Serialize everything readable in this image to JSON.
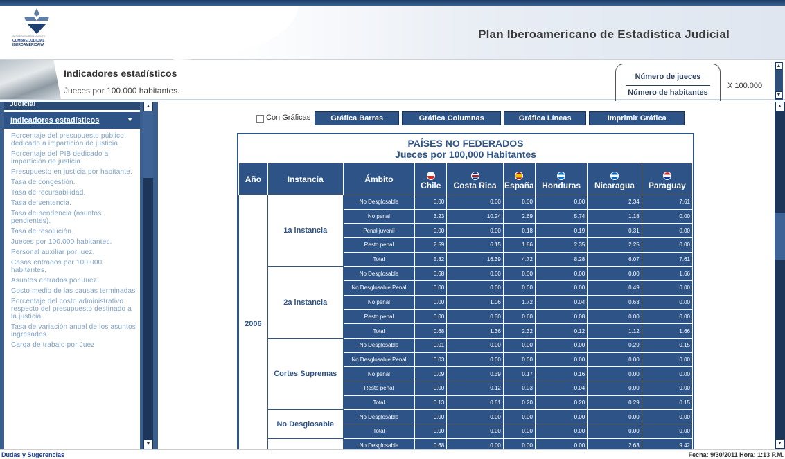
{
  "header": {
    "site_title": "Plan Iberoamericano de Estadística Judicial",
    "logo_small": "SECRETARIA PERMANENTE",
    "logo_line1": "CUMBRE JUDICIAL",
    "logo_line2": "IBEROAMERICANA"
  },
  "subheader": {
    "title": "Indicadores estadísticos",
    "description": "Jueces por 100.000 habitantes.",
    "numerator": "Número de jueces",
    "denominator": "Número de habitantes",
    "multiplier": "X 100.000"
  },
  "sidebar": {
    "partial_item": "Judicial",
    "section": "Indicadores estadísticos",
    "items": [
      "Porcentaje del presupuesto público dedicado a impartición de justicia",
      "Porcentaje del PIB dedicado a impartición de justicia",
      "Presupuesto en justicia por habitante.",
      "Tasa de congestión.",
      "Tasa de recursabilidad.",
      "Tasa de sentencia.",
      "Tasa de pendencia (asuntos pendientes).",
      "Tasa de resolución.",
      "Jueces por 100.000 habitantes.",
      "Personal auxiliar por juez.",
      "Casos entrados por 100.000 habitantes.",
      "Asuntos entrados por Juez.",
      "Costo medio de las causas terminadas",
      "Porcentaje del costo administrativo respecto del presupuesto destinado a la justicia",
      "Tasa de variación anual de los asuntos ingresados.",
      "Carga de trabajo por Juez"
    ]
  },
  "controls": {
    "checkbox_label": "Con Gráficas",
    "btn_bars": "Gráfica Barras",
    "btn_columns": "Gráfica Columnas",
    "btn_lines": "Gráfica Líneas",
    "btn_print": "Imprimir Gráfica"
  },
  "table": {
    "title_line1": "PAÍSES NO FEDERADOS",
    "title_line2": "Jueces por 100,000 Habitantes",
    "headers": [
      "Año",
      "Instancia",
      "Ámbito",
      "Chile",
      "Costa Rica",
      "España",
      "Honduras",
      "Nicaragua",
      "Paraguay"
    ],
    "year": "2006",
    "groups": [
      {
        "instancia": "1a instancia",
        "rows": [
          {
            "ambito": "No Desglosable",
            "v": [
              "0.00",
              "0.00",
              "0.00",
              "0.00",
              "2.34",
              "7.61"
            ]
          },
          {
            "ambito": "No penal",
            "v": [
              "3.23",
              "10.24",
              "2.69",
              "5.74",
              "1.18",
              "0.00"
            ]
          },
          {
            "ambito": "Penal juvenil",
            "v": [
              "0.00",
              "0.00",
              "0.18",
              "0.19",
              "0.31",
              "0.00"
            ]
          },
          {
            "ambito": "Resto penal",
            "v": [
              "2.59",
              "6.15",
              "1.86",
              "2.35",
              "2.25",
              "0.00"
            ]
          },
          {
            "ambito": "Total",
            "v": [
              "5.82",
              "16.39",
              "4.72",
              "8.28",
              "6.07",
              "7.61"
            ]
          }
        ]
      },
      {
        "instancia": "2a instancia",
        "rows": [
          {
            "ambito": "No Desglosable",
            "v": [
              "0.68",
              "0.00",
              "0.00",
              "0.00",
              "0.00",
              "1.66"
            ]
          },
          {
            "ambito": "No Desglosable Penal",
            "v": [
              "0.00",
              "0.00",
              "0.00",
              "0.00",
              "0.49",
              "0.00"
            ]
          },
          {
            "ambito": "No penal",
            "v": [
              "0.00",
              "1.06",
              "1.72",
              "0.04",
              "0.63",
              "0.00"
            ]
          },
          {
            "ambito": "Resto penal",
            "v": [
              "0.00",
              "0.30",
              "0.60",
              "0.08",
              "0.00",
              "0.00"
            ]
          },
          {
            "ambito": "Total",
            "v": [
              "0.68",
              "1.36",
              "2.32",
              "0.12",
              "1.12",
              "1.66"
            ]
          }
        ]
      },
      {
        "instancia": "Cortes Supremas",
        "rows": [
          {
            "ambito": "No Desglosable",
            "v": [
              "0.01",
              "0.00",
              "0.00",
              "0.00",
              "0.29",
              "0.15"
            ]
          },
          {
            "ambito": "No Desglosable Penal",
            "v": [
              "0.03",
              "0.00",
              "0.00",
              "0.00",
              "0.00",
              "0.00"
            ]
          },
          {
            "ambito": "No penal",
            "v": [
              "0.09",
              "0.39",
              "0.17",
              "0.16",
              "0.00",
              "0.00"
            ]
          },
          {
            "ambito": "Resto penal",
            "v": [
              "0.00",
              "0.12",
              "0.03",
              "0.04",
              "0.00",
              "0.00"
            ]
          },
          {
            "ambito": "Total",
            "v": [
              "0.13",
              "0.51",
              "0.20",
              "0.20",
              "0.29",
              "0.15"
            ]
          }
        ]
      },
      {
        "instancia": "No Desglosable",
        "rows": [
          {
            "ambito": "No Desglosable",
            "v": [
              "0.00",
              "0.00",
              "0.00",
              "0.00",
              "0.00",
              "0.00"
            ]
          },
          {
            "ambito": "Total",
            "v": [
              "0.00",
              "0.00",
              "0.00",
              "0.00",
              "0.00",
              "0.00"
            ]
          }
        ]
      },
      {
        "instancia": "",
        "rows": [
          {
            "ambito": "No Desglosable",
            "v": [
              "0.68",
              "0.00",
              "0.00",
              "0.00",
              "2.63",
              "9.42"
            ]
          }
        ]
      }
    ]
  },
  "footer": {
    "link": "Dudas y Sugerencias",
    "date": "Fecha: 9/30/2011 Hora: 1:13 P.M."
  },
  "colors": {
    "primary": "#2d5387",
    "dark": "#1d3558",
    "sidebar_link": "#7ea2c7"
  }
}
